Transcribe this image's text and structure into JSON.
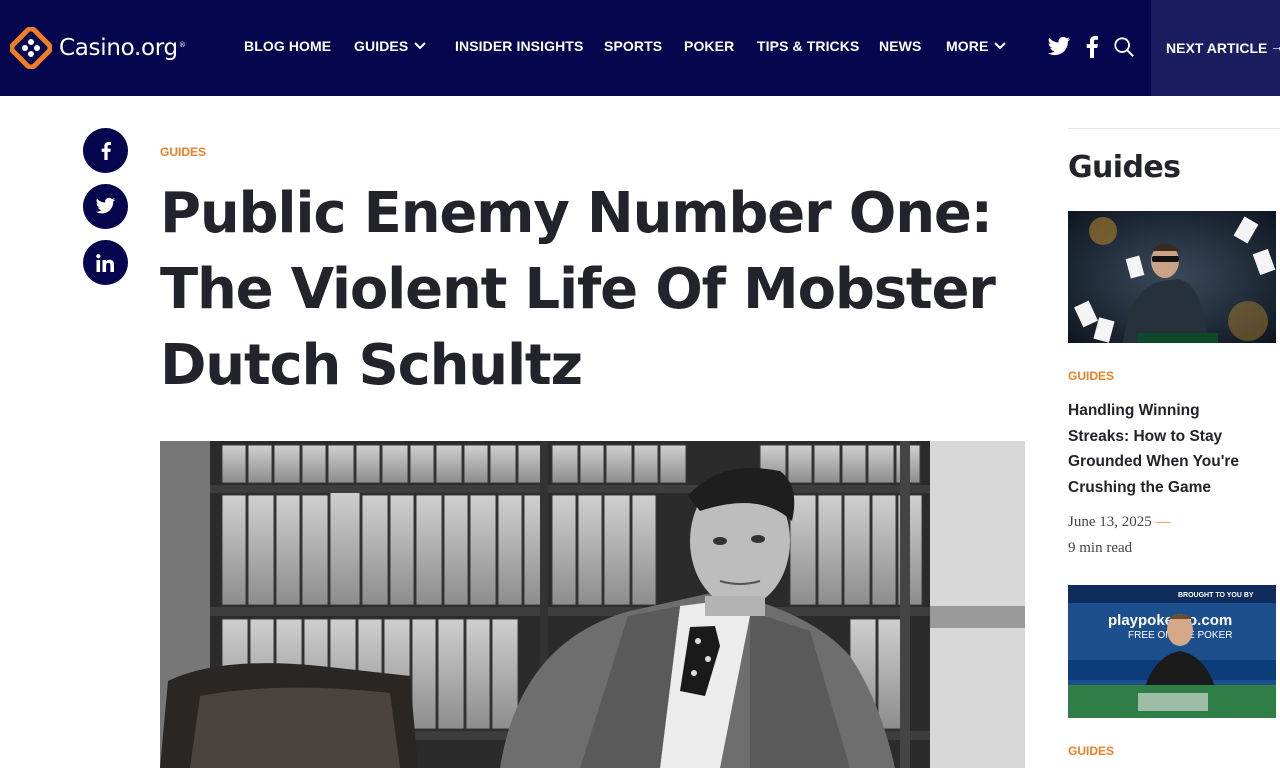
{
  "header": {
    "logo_text": "Casino.org",
    "logo_tm": "®",
    "nav": [
      {
        "label": "BLOG HOME",
        "dropdown": false
      },
      {
        "label": "GUIDES",
        "dropdown": true
      },
      {
        "label": "INSIDER INSIGHTS",
        "dropdown": false
      },
      {
        "label": "SPORTS",
        "dropdown": false
      },
      {
        "label": "POKER",
        "dropdown": false
      },
      {
        "label": "TIPS & TRICKS",
        "dropdown": false
      },
      {
        "label": "NEWS",
        "dropdown": false
      },
      {
        "label": "MORE",
        "dropdown": true
      }
    ],
    "social_icons": [
      "twitter-icon",
      "facebook-icon",
      "search-icon"
    ],
    "next_article": {
      "label": "NEXT ARTICLE",
      "arrow": "→"
    }
  },
  "share_buttons": [
    "facebook-icon",
    "twitter-icon",
    "linkedin-icon"
  ],
  "article": {
    "category": "GUIDES",
    "title_lines": [
      "Public Enemy Number One:",
      "The Violent Life Of Mobster",
      "Dutch Schultz"
    ],
    "hero_image": "black-and-white photo of man in suit seated in front of law-book shelves"
  },
  "sidebar": {
    "heading": "Guides",
    "cards": [
      {
        "category": "GUIDES",
        "title_lines": [
          "Handling Winning",
          "Streaks: How to Stay",
          "Grounded When You're",
          "Crushing the Game"
        ],
        "date": "June 13, 2025",
        "dash": "—",
        "read_time": "9 min read"
      },
      {
        "category": "GUIDES",
        "thumb_banner_text": "playpokergo.com",
        "thumb_sub_text": "FREE ONLINE POKER",
        "thumb_top_text": "BROUGHT TO YOU BY"
      }
    ]
  },
  "colors": {
    "header_bg": "#05064d",
    "next_article_bg": "#1b1d60",
    "accent": "#f07d22",
    "text_dark": "#23232b"
  }
}
